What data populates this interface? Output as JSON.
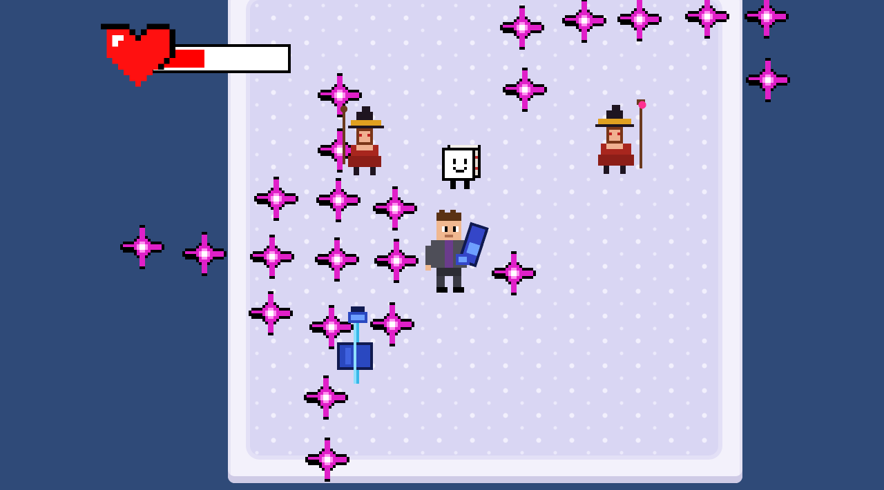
{
  "hud": {
    "health": {
      "fraction": 0.38,
      "color": "#ff0000",
      "icon": "heart-icon"
    }
  },
  "colors": {
    "background": "#2f4a78",
    "floor": "#d9d6f3",
    "border": "#f3f1fb",
    "sparkle": "#e020c8",
    "witch_robe": "#a8261e"
  },
  "entities": {
    "player": "player-with-blaster",
    "dice": "white-dice-creature",
    "witch_left": "witch-enemy",
    "witch_right": "witch-enemy-with-staff",
    "pickup": "blue-sword-pickup",
    "projectile": "magenta-sparkle-projectile"
  }
}
